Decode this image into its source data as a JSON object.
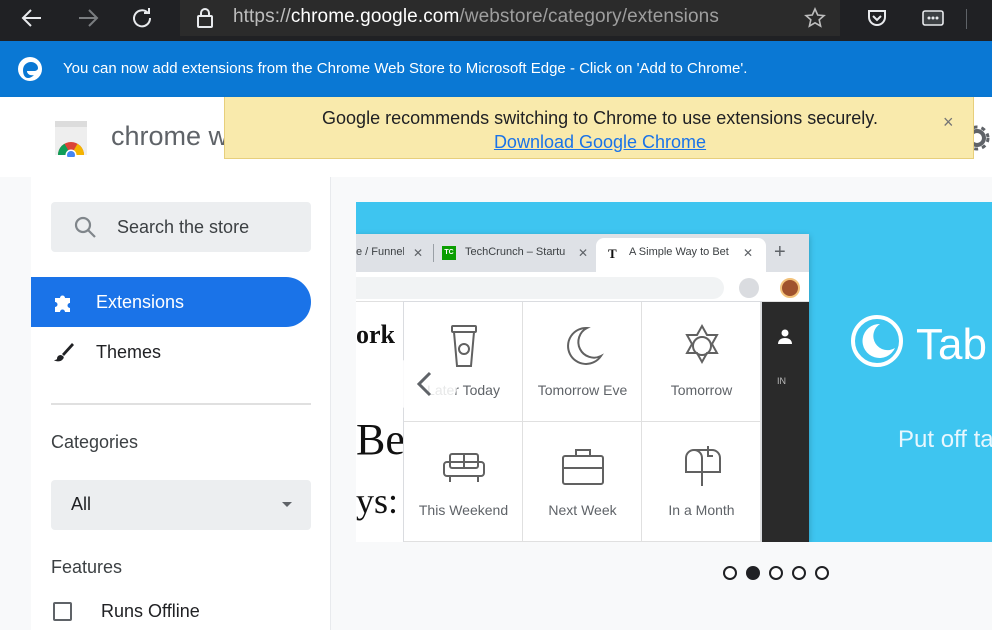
{
  "browser": {
    "url_scheme": "https://",
    "url_host": "chrome.google.com",
    "url_path": "/webstore/category/extensions",
    "icons": [
      "back-arrow-icon",
      "forward-arrow-icon",
      "reload-icon",
      "lock-icon",
      "star-icon",
      "pocket-icon",
      "more-icon"
    ]
  },
  "edge_bar": {
    "message": "You can now add extensions from the Chrome Web Store to Microsoft Edge - Click on 'Add to Chrome'."
  },
  "store_header": {
    "title": "chrome w"
  },
  "notice": {
    "message": "Google recommends switching to Chrome to use extensions securely.",
    "link": "Download Google Chrome",
    "close": "×"
  },
  "sidebar": {
    "search_placeholder": "Search the store",
    "nav": [
      {
        "label": "Extensions",
        "active": true
      },
      {
        "label": "Themes",
        "active": false
      }
    ],
    "categories_heading": "Categories",
    "category_selected": "All",
    "features_heading": "Features",
    "features": [
      {
        "label": "Runs Offline",
        "checked": false
      }
    ]
  },
  "carousel": {
    "mock_tabs": [
      "e / Funnel",
      "TechCrunch – Startu",
      "A Simple Way to Bet"
    ],
    "tc_badge": "TC",
    "nyt_badge": "T",
    "page_glyphs": [
      "ork",
      "Be",
      "ys:"
    ],
    "nyt_header": "IN",
    "options": [
      "Later Today",
      "Tomorrow Eve",
      "Tomorrow",
      "This Weekend",
      "Next Week",
      "In a Month"
    ],
    "brand_text": "Tab",
    "tagline": "Put off ta",
    "slide_count": 5,
    "active_slide": 1
  },
  "colors": {
    "edge_blue": "#0a78d4",
    "chrome_blue": "#1a73e8",
    "notice_yellow": "#f9eaac",
    "carousel_blue": "#3ec5f0"
  }
}
